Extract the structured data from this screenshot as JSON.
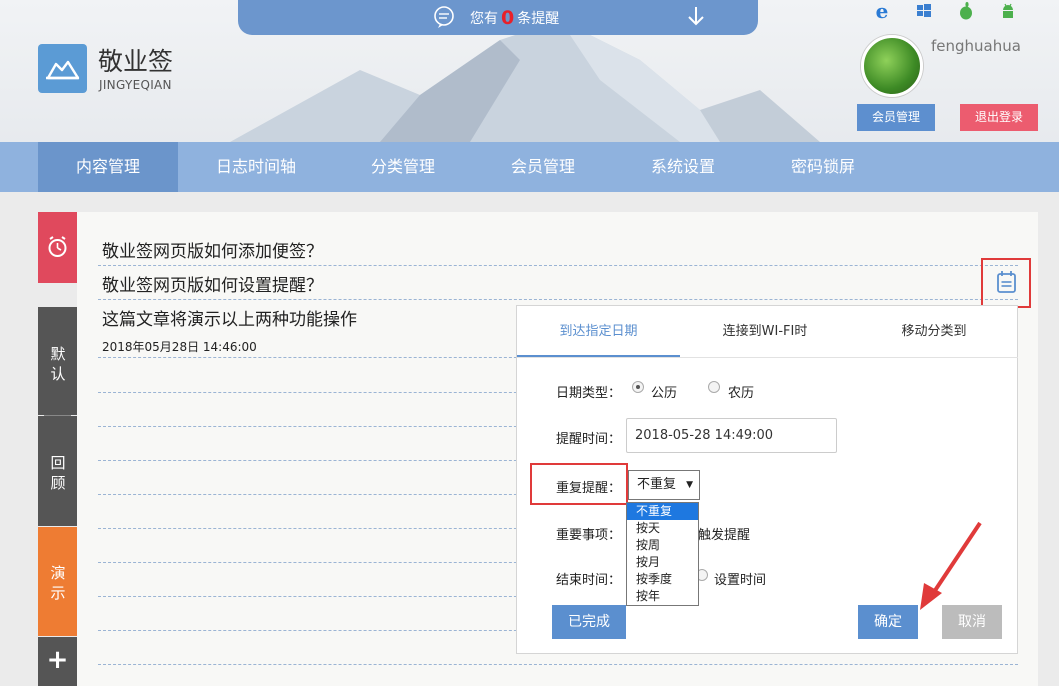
{
  "notice": {
    "prefix": "您有",
    "count": "0",
    "suffix": "条提醒"
  },
  "logo": {
    "title": "敬业签",
    "subtitle": "JINGYEQIAN"
  },
  "platforms": [
    "ie-icon",
    "windows-icon",
    "apple-icon",
    "android-icon"
  ],
  "user": {
    "name": "fenghuahua",
    "member_btn": "会员管理",
    "logout_btn": "退出登录"
  },
  "nav": [
    "内容管理",
    "日志时间轴",
    "分类管理",
    "会员管理",
    "系统设置",
    "密码锁屏"
  ],
  "sidebar": [
    "默认",
    "回顾",
    "演示",
    "+"
  ],
  "note": {
    "line1": "敬业签网页版如何添加便签？",
    "line2": "敬业签网页版如何设置提醒？",
    "line3": "这篇文章将演示以上两种功能操作",
    "date": "2018年05月28日 14:46:00"
  },
  "popup": {
    "tabs": [
      "到达指定日期",
      "连接到WI-FI时",
      "移动分类到"
    ],
    "date_type_label": "日期类型：",
    "solar": "公历",
    "lunar": "农历",
    "remind_time_label": "提醒时间：",
    "remind_time": "2018-05-28 14:49:00",
    "repeat_label": "重复提醒：",
    "repeat_value": "不重复",
    "repeat_options": [
      "不重复",
      "按天",
      "按周",
      "按月",
      "按季度",
      "按年"
    ],
    "important_label": "重要事项：",
    "important_text": "触发提醒",
    "end_label": "结束时间：",
    "end_text": "设置时间",
    "done_btn": "已完成",
    "ok_btn": "确定",
    "cancel_btn": "取消"
  },
  "colors": {
    "accent": "#5b8fcf",
    "nav": "#8fb2de",
    "danger": "#e03a3a",
    "alarm": "#e0495d",
    "demo": "#ee7c33"
  }
}
